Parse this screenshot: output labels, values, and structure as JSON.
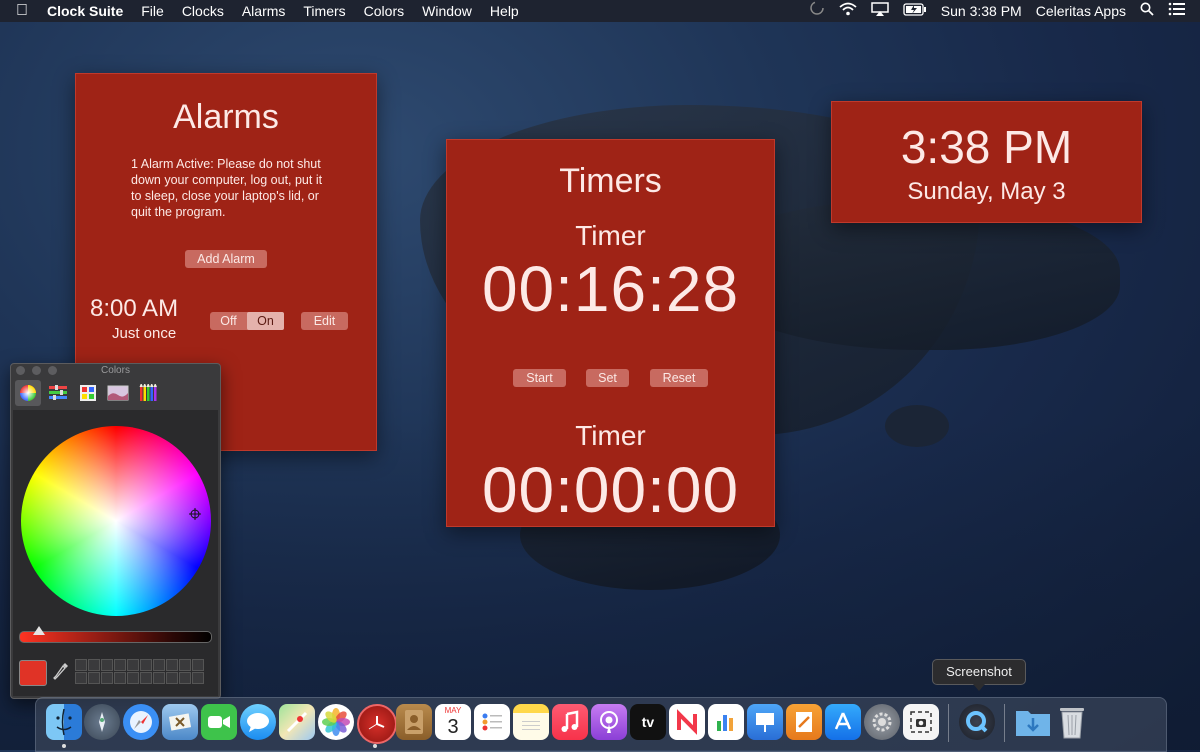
{
  "menubar": {
    "apple_icon": "apple-icon",
    "app_name": "Clock Suite",
    "menus": [
      "File",
      "Clocks",
      "Alarms",
      "Timers",
      "Colors",
      "Window",
      "Help"
    ],
    "clock": "Sun 3:38 PM",
    "user": "Celeritas Apps"
  },
  "alarms": {
    "title": "Alarms",
    "notice": "1 Alarm Active: Please do not shut down your computer, log out, put it to sleep, close your laptop's lid, or quit the program.",
    "add_label": "Add Alarm",
    "alarm": {
      "time": "8:00 AM",
      "repeat": "Just once",
      "off_label": "Off",
      "on_label": "On",
      "state": "On",
      "edit_label": "Edit"
    }
  },
  "timers": {
    "title": "Timers",
    "timer1": {
      "label": "Timer",
      "value": "00:16:28"
    },
    "start_label": "Start",
    "set_label": "Set",
    "reset_label": "Reset",
    "timer2": {
      "label": "Timer",
      "value": "00:00:00"
    }
  },
  "clock": {
    "time": "3:38 PM",
    "date": "Sunday, May 3"
  },
  "colors_panel": {
    "title": "Colors",
    "modes": [
      "color-wheel-icon",
      "sliders-icon",
      "palettes-icon",
      "image-palettes-icon",
      "pencils-icon"
    ],
    "active_mode": "color-wheel-icon",
    "selected_color": "#e03326"
  },
  "tooltip": {
    "text": "Screenshot"
  },
  "dock": {
    "items": [
      "Finder",
      "Launchpad",
      "Safari",
      "Mail",
      "FaceTime",
      "Messages",
      "Maps",
      "Photos",
      "Clock Suite",
      "Contacts",
      "Calendar",
      "Reminders",
      "Notes",
      "Music",
      "Podcasts",
      "TV",
      "News",
      "Numbers",
      "Keynote",
      "Pages",
      "App Store",
      "System Preferences",
      "Screenshot",
      "QuickTime Player",
      "Downloads",
      "Trash"
    ],
    "calendar_month": "MAY",
    "calendar_day": "3",
    "tv_label": "tv"
  },
  "colors": {
    "panel_red": "#9f2316",
    "button_red": "#c86a60",
    "menubar": "#1e2330"
  }
}
